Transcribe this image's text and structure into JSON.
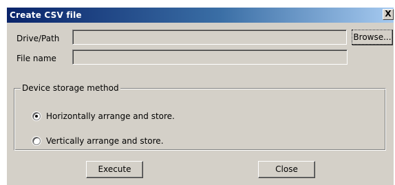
{
  "window": {
    "title": "Create CSV file",
    "close_glyph": "X"
  },
  "drive_path": {
    "label": "Drive/Path",
    "value": ""
  },
  "file_name": {
    "label": "File name",
    "value": ""
  },
  "browse_button": {
    "label": "Browse..."
  },
  "storage_group": {
    "title": "Device storage method",
    "options": [
      {
        "label": "Horizontally arrange and store.",
        "checked": true
      },
      {
        "label": "Vertically arrange and store.",
        "checked": false
      }
    ]
  },
  "buttons": {
    "execute": "Execute",
    "close": "Close"
  }
}
